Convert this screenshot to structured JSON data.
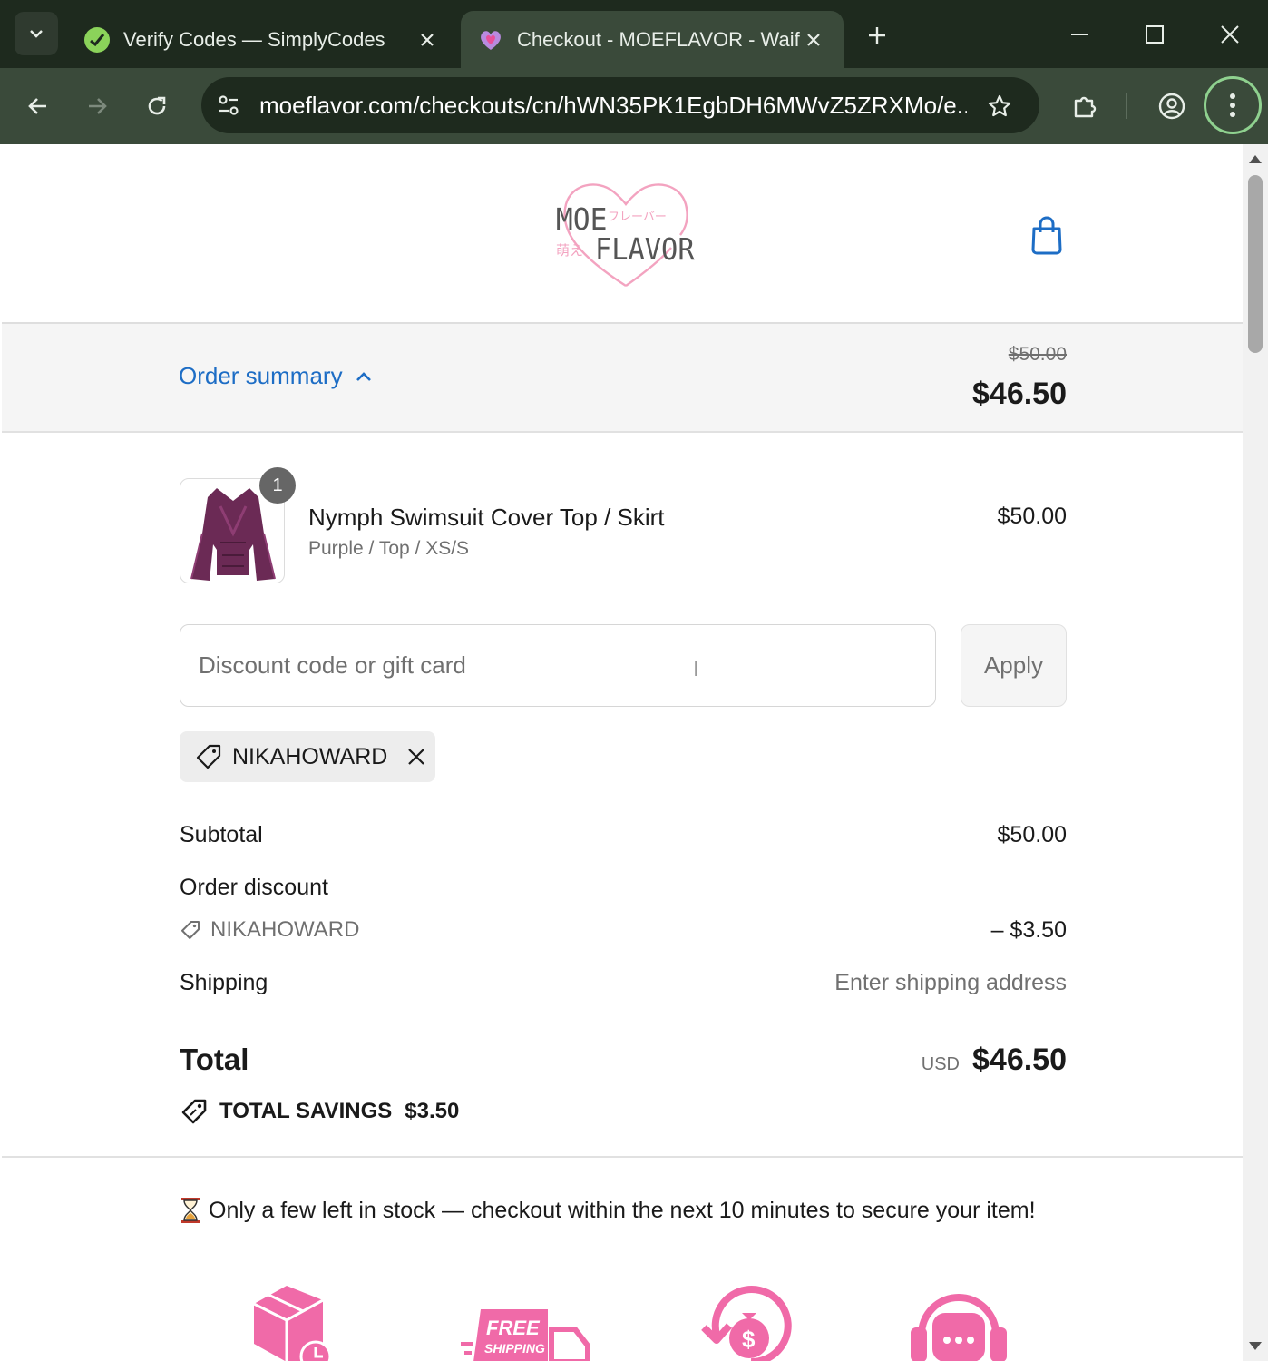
{
  "browser": {
    "tabs": [
      {
        "title": "Verify Codes — SimplyCodes",
        "active": false,
        "favicon": "simplycodes-icon"
      },
      {
        "title": "Checkout - MOEFLAVOR - Waifu",
        "active": true,
        "favicon": "heart-favicon-icon"
      }
    ],
    "url": "moeflavor.com/checkouts/cn/hWN35PK1EgbDH6MWvZ5ZRXMo/e...",
    "colors": {
      "frame": "#1e2a1e",
      "toolbar": "#3a4a3a",
      "menu_ring": "#8fd18f"
    }
  },
  "header": {
    "logo": {
      "text_main_1": "MOE",
      "text_main_2": "FLAVOR",
      "text_jp_1": "フレーバー",
      "text_jp_2": "萌え",
      "color": "#f3a3c0"
    },
    "cart_icon": "shopping-bag-icon"
  },
  "summary": {
    "toggle_label": "Order summary",
    "original_price": "$50.00",
    "price": "$46.50"
  },
  "item": {
    "quantity": "1",
    "name": "Nymph Swimsuit Cover Top / Skirt",
    "variant": "Purple / Top / XS/S",
    "price": "$50.00"
  },
  "discount": {
    "placeholder": "Discount code or gift card",
    "apply_label": "Apply",
    "applied_code": "NIKAHOWARD"
  },
  "totals": {
    "subtotal_label": "Subtotal",
    "subtotal_value": "$50.00",
    "order_discount_label": "Order discount",
    "discount_code": "NIKAHOWARD",
    "discount_value": "– $3.50",
    "shipping_label": "Shipping",
    "shipping_value": "Enter shipping address",
    "total_label": "Total",
    "currency": "USD",
    "total_value": "$46.50",
    "savings_label": "TOTAL SAVINGS",
    "savings_value": "$3.50"
  },
  "notice": {
    "stock_text": "Only a few left in stock — checkout within the next 10 minutes to secure your item!"
  },
  "badges": {
    "free_shipping_line1": "FREE",
    "free_shipping_line2": "SHIPPING",
    "icons": [
      "package-clock-icon",
      "free-shipping-truck-icon",
      "money-return-icon",
      "support-headset-icon"
    ],
    "accent": "#f06aa8"
  }
}
